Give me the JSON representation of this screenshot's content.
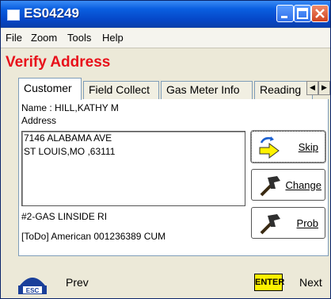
{
  "window": {
    "title": "ES04249"
  },
  "menu": {
    "file": "File",
    "zoom": "Zoom",
    "tools": "Tools",
    "help": "Help"
  },
  "page": {
    "heading": "Verify Address"
  },
  "tabs": [
    {
      "label": "Customer"
    },
    {
      "label": "Field Collect"
    },
    {
      "label": "Gas Meter Info"
    },
    {
      "label": "Reading"
    }
  ],
  "customer": {
    "name": "Name : HILL,KATHY M",
    "address_label": "Address",
    "address_lines": [
      "7146 ALABAMA AVE",
      "ST LOUIS,MO ,63111"
    ],
    "meter_location": "#2-GAS LINSIDE RI",
    "todo": "[ToDo] American 001236389 CUM"
  },
  "buttons": {
    "skip": "Skip",
    "change": "Change",
    "prob": "Prob"
  },
  "footer": {
    "esc": "ESC",
    "prev": "Prev",
    "enter": "ENTER",
    "next": "Next"
  },
  "colors": {
    "heading": "#E8101A",
    "titlebar": "#0547C8",
    "enter_key": "#FFF200"
  }
}
